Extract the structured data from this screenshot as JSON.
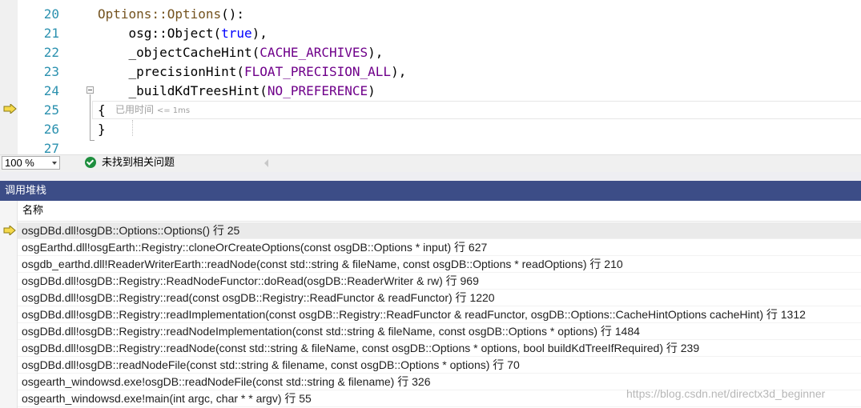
{
  "editor": {
    "lines": [
      {
        "number": "20",
        "segments": [
          {
            "text": "Options::Options",
            "cls": "tok-fn"
          },
          {
            "text": "():",
            "cls": "tok-member"
          }
        ]
      },
      {
        "number": "21",
        "segments": [
          {
            "text": "    osg::Object(",
            "cls": "tok-member"
          },
          {
            "text": "true",
            "cls": "tok-kw"
          },
          {
            "text": "),",
            "cls": "tok-member"
          }
        ]
      },
      {
        "number": "22",
        "segments": [
          {
            "text": "    _objectCacheHint(",
            "cls": "tok-member"
          },
          {
            "text": "CACHE_ARCHIVES",
            "cls": "tok-macro"
          },
          {
            "text": "),",
            "cls": "tok-member"
          }
        ]
      },
      {
        "number": "23",
        "segments": [
          {
            "text": "    _precisionHint(",
            "cls": "tok-member"
          },
          {
            "text": "FLOAT_PRECISION_ALL",
            "cls": "tok-macro"
          },
          {
            "text": "),",
            "cls": "tok-member"
          }
        ]
      },
      {
        "number": "24",
        "segments": [
          {
            "text": "    _buildKdTreesHint(",
            "cls": "tok-member"
          },
          {
            "text": "NO_PREFERENCE",
            "cls": "tok-macro"
          },
          {
            "text": ")",
            "cls": "tok-member"
          }
        ]
      },
      {
        "number": "25",
        "segments": [
          {
            "text": "{",
            "cls": "tok-member"
          }
        ]
      },
      {
        "number": "26",
        "segments": [
          {
            "text": "}",
            "cls": "tok-member"
          }
        ]
      },
      {
        "number": "27",
        "segments": []
      }
    ],
    "perf_tip": "已用时间",
    "perf_tip_value": "<= 1ms"
  },
  "status": {
    "zoom": "100 %",
    "issues": "未找到相关问题"
  },
  "call_stack": {
    "title": "调用堆栈",
    "column_name": "名称",
    "rows": [
      "osgDBd.dll!osgDB::Options::Options() 行 25",
      "osgEarthd.dll!osgEarth::Registry::cloneOrCreateOptions(const osgDB::Options * input) 行 627",
      "osgdb_earthd.dll!ReaderWriterEarth::readNode(const std::string & fileName, const osgDB::Options * readOptions) 行 210",
      "osgDBd.dll!osgDB::Registry::ReadNodeFunctor::doRead(osgDB::ReaderWriter & rw) 行 969",
      "osgDBd.dll!osgDB::Registry::read(const osgDB::Registry::ReadFunctor & readFunctor) 行 1220",
      "osgDBd.dll!osgDB::Registry::readImplementation(const osgDB::Registry::ReadFunctor & readFunctor, osgDB::Options::CacheHintOptions cacheHint) 行 1312",
      "osgDBd.dll!osgDB::Registry::readNodeImplementation(const std::string & fileName, const osgDB::Options * options) 行 1484",
      "osgDBd.dll!osgDB::Registry::readNode(const std::string & fileName, const osgDB::Options * options, bool buildKdTreeIfRequired) 行 239",
      "osgDBd.dll!osgDB::readNodeFile(const std::string & filename, const osgDB::Options * options) 行 70",
      "osgearth_windowsd.exe!osgDB::readNodeFile(const std::string & filename) 行 326",
      "osgearth_windowsd.exe!main(int argc, char * * argv) 行 55"
    ]
  },
  "watermark": "https://blog.csdn.net/directx3d_beginner",
  "colors": {
    "panel_title_bg": "#3c4d87",
    "line_number": "#2b91af",
    "exec_arrow": "#f5d94a"
  }
}
